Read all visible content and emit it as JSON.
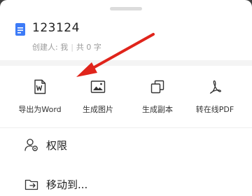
{
  "document": {
    "title": "123124",
    "creator": "创建人: 我",
    "word_count": "共 0 字"
  },
  "actions": [
    {
      "label": "导出为Word",
      "icon": "word-export-icon"
    },
    {
      "label": "生成图片",
      "icon": "image-icon"
    },
    {
      "label": "生成副本",
      "icon": "copy-icon"
    },
    {
      "label": "转在线PDF",
      "icon": "pdf-icon"
    }
  ],
  "menu": [
    {
      "label": "权限",
      "icon": "permission-icon"
    },
    {
      "label": "移动到...",
      "icon": "move-folder-icon"
    }
  ],
  "colors": {
    "doc_icon": "#3d7bf7",
    "annotation_arrow": "#e0241b"
  }
}
